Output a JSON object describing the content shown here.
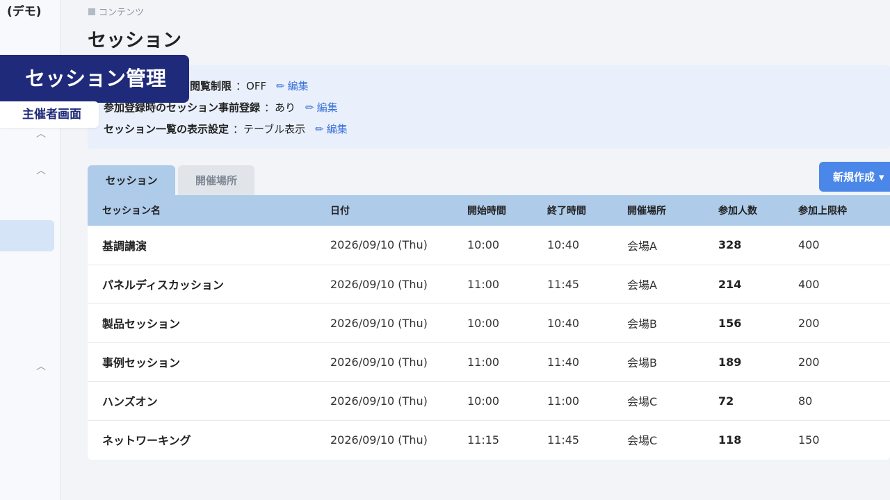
{
  "sidebar": {
    "demo_label": "(デモ)"
  },
  "overlay": {
    "title": "セッション管理",
    "subtitle": "主催者画面"
  },
  "breadcrumb": {
    "label": "コンテンツ"
  },
  "page": {
    "title": "セッション"
  },
  "settings": [
    {
      "label": "閲覧制限",
      "value": "：OFF",
      "edit": "編集"
    },
    {
      "label": "参加登録時のセッション事前登録",
      "value": "：あり",
      "edit": "編集"
    },
    {
      "label": "セッション一覧の表示設定",
      "value": "：テーブル表示",
      "edit": "編集"
    }
  ],
  "tabs": [
    {
      "label": "セッション"
    },
    {
      "label": "開催場所"
    }
  ],
  "new_button": {
    "label": "新規作成",
    "caret": "▾"
  },
  "table": {
    "headers": [
      "セッション名",
      "日付",
      "開始時間",
      "終了時間",
      "開催場所",
      "参加人数",
      "参加上限枠"
    ],
    "rows": [
      [
        "基調講演",
        "2026/09/10 (Thu)",
        "10:00",
        "10:40",
        "会場A",
        "328",
        "400"
      ],
      [
        "パネルディスカッション",
        "2026/09/10 (Thu)",
        "11:00",
        "11:45",
        "会場A",
        "214",
        "400"
      ],
      [
        "製品セッション",
        "2026/09/10 (Thu)",
        "10:00",
        "10:40",
        "会場B",
        "156",
        "200"
      ],
      [
        "事例セッション",
        "2026/09/10 (Thu)",
        "11:00",
        "11:40",
        "会場B",
        "189",
        "200"
      ],
      [
        "ハンズオン",
        "2026/09/10 (Thu)",
        "10:00",
        "11:00",
        "会場C",
        "72",
        "80"
      ],
      [
        "ネットワーキング",
        "2026/09/10 (Thu)",
        "11:15",
        "11:45",
        "会場C",
        "118",
        "150"
      ]
    ]
  },
  "colors": {
    "overlay_bg": "#1f2a7a",
    "accent": "#4b87e8",
    "header_bg": "#aecbea",
    "link": "#3d72d8"
  }
}
